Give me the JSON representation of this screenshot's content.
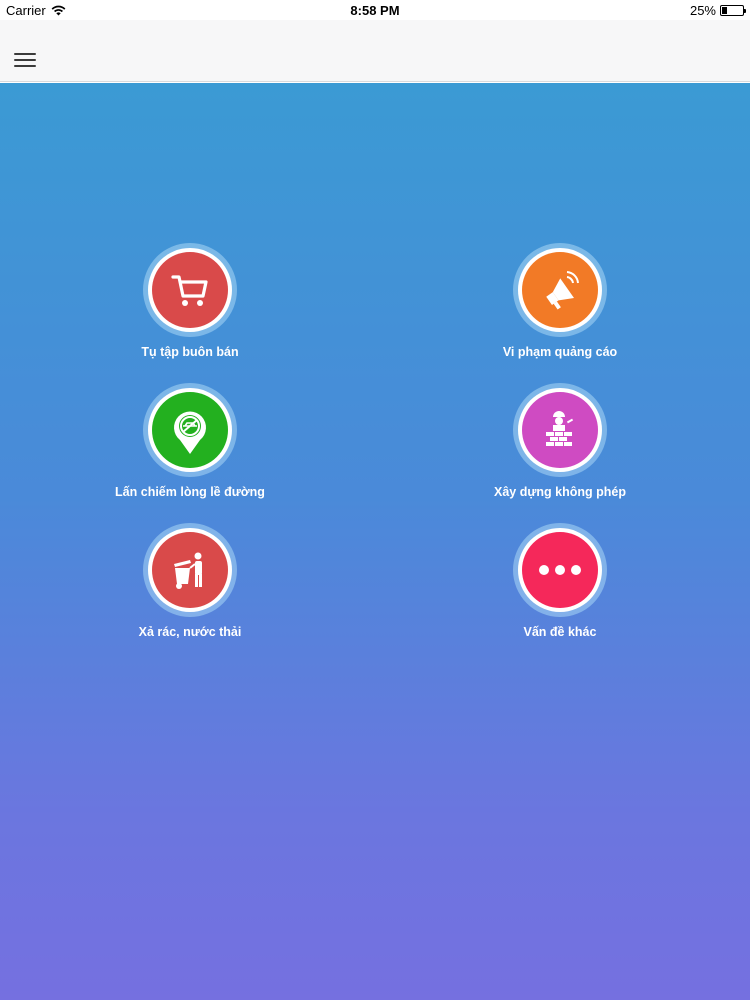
{
  "status_bar": {
    "carrier": "Carrier",
    "time": "8:58 PM",
    "battery_percent": "25%",
    "battery_level": 0.25
  },
  "nav": {
    "menu_icon": "hamburger-menu-icon"
  },
  "categories": [
    {
      "label": "Tụ tập buôn bán",
      "icon": "shopping-cart-icon",
      "color": "#d94a4a"
    },
    {
      "label": "Vi phạm quảng cáo",
      "icon": "megaphone-icon",
      "color": "#f27a26"
    },
    {
      "label": "Lấn chiếm lòng lề đường",
      "icon": "no-parking-pin-icon",
      "color": "#23b01f"
    },
    {
      "label": "Xây dựng không phép",
      "icon": "construction-worker-icon",
      "color": "#cf4bc2"
    },
    {
      "label": "Xả rác, nước thải",
      "icon": "trash-bin-icon",
      "color": "#d94a4a"
    },
    {
      "label": "Vấn đề khác",
      "icon": "more-dots-icon",
      "color": "#f5285a"
    }
  ]
}
